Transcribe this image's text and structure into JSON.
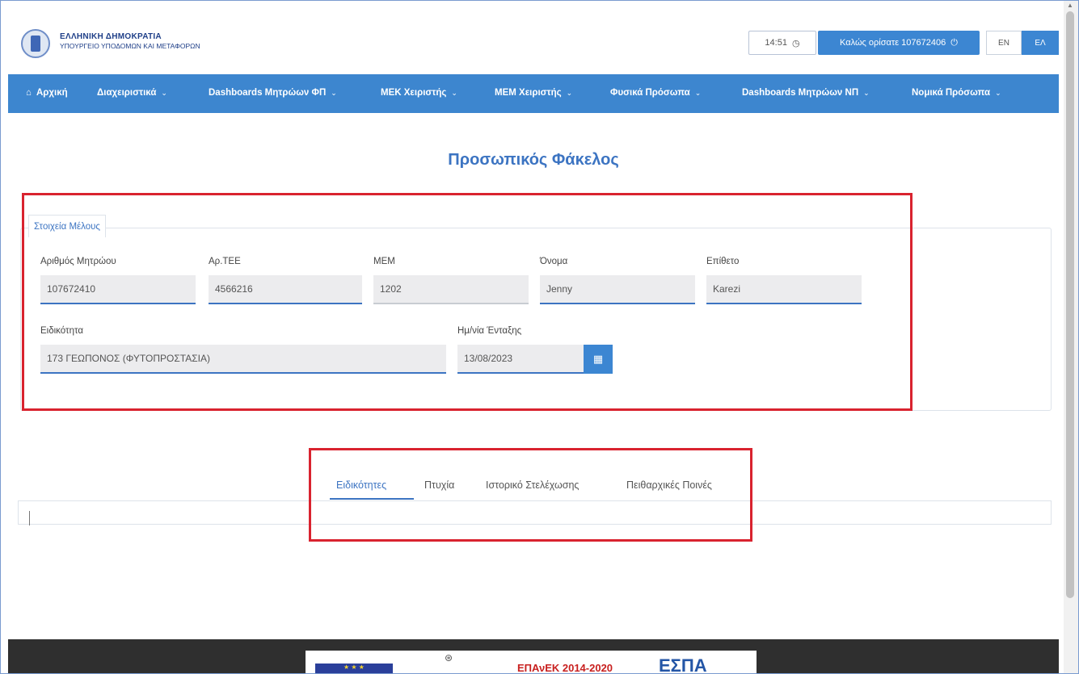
{
  "header": {
    "gov_title": "ΕΛΛΗΝΙΚΗ ΔΗΜΟΚΡΑΤΙΑ",
    "gov_subtitle": "ΥΠΟΥΡΓΕΙΟ ΥΠΟΔΟΜΩΝ ΚΑΙ ΜΕΤΑΦΟΡΩΝ",
    "clock": "14:51",
    "welcome": "Καλώς ορίσατε 107672406",
    "lang_en": "EN",
    "lang_el": "ΕΛ"
  },
  "nav": {
    "home": "Αρχική",
    "items": [
      "Διαχειριστικά",
      "Dashboards Μητρώων ΦΠ",
      "ΜΕΚ Χειριστής",
      "ΜΕΜ Χειριστής",
      "Φυσικά Πρόσωπα",
      "Dashboards Μητρώων ΝΠ",
      "Νομικά Πρόσωπα"
    ]
  },
  "page": {
    "title": "Προσωπικός Φάκελος"
  },
  "member": {
    "legend": "Στοιχεία Μέλους",
    "fields": {
      "registry_label": "Αριθμός Μητρώου",
      "registry_value": "107672410",
      "tee_label": "Αρ.ΤΕΕ",
      "tee_value": "4566216",
      "mem_label": "ΜΕΜ",
      "mem_value": "1202",
      "name_label": "Όνομα",
      "name_value": "Jenny",
      "surname_label": "Επίθετο",
      "surname_value": "Karezi",
      "specialty_label": "Ειδικότητα",
      "specialty_value": "173 ΓΕΩΠΟΝΟΣ (ΦΥΤΟΠΡΟΣΤΑΣΙΑ)",
      "date_label": "Ημ/νία Ένταξης",
      "date_value": "13/08/2023"
    }
  },
  "tabs": [
    "Ειδικότητες",
    "Πτυχία",
    "Ιστορικό Στελέχωσης",
    "Πειθαρχικές Ποινές"
  ],
  "footer": {
    "epanek": "ΕΠΑνΕΚ 2014-2020",
    "espa": "ΕΣΠΑ"
  },
  "colors": {
    "primary": "#3c86d2",
    "title_blue": "#3c74c2",
    "annotation_red": "#d9232f"
  }
}
